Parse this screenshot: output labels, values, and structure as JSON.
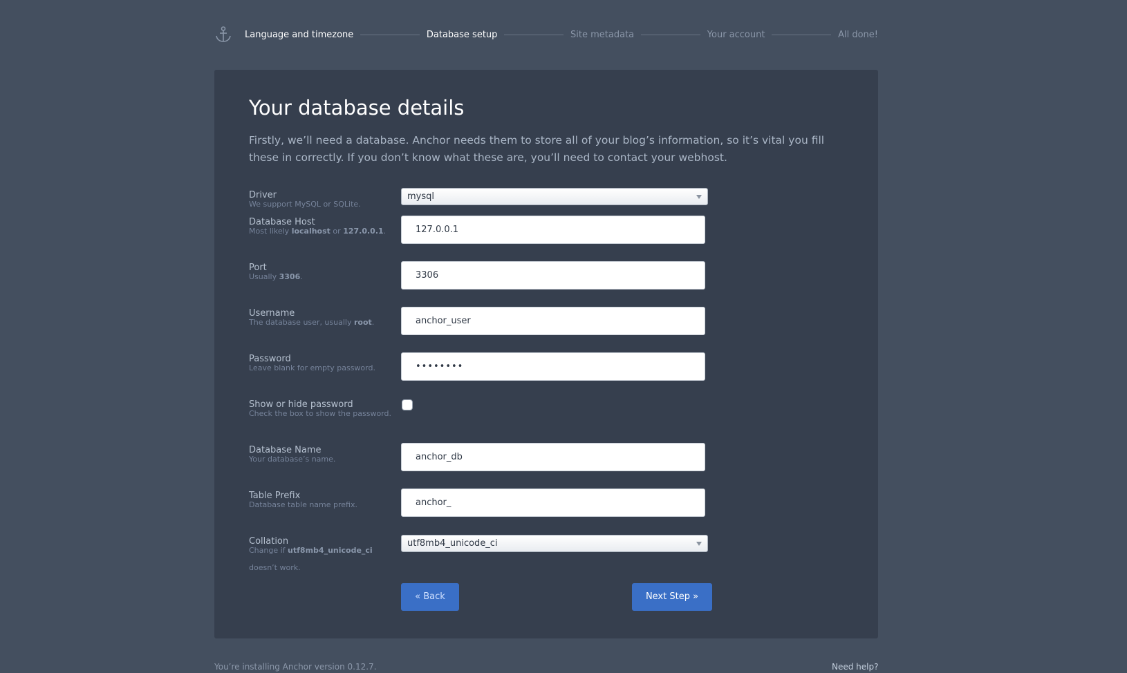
{
  "steps": [
    {
      "label": "Language and timezone",
      "state": "done"
    },
    {
      "label": "Database setup",
      "state": "current"
    },
    {
      "label": "Site metadata",
      "state": "upcoming"
    },
    {
      "label": "Your account",
      "state": "upcoming"
    },
    {
      "label": "All done!",
      "state": "upcoming"
    }
  ],
  "page": {
    "title": "Your database details",
    "intro": "Firstly, we’ll need a database. Anchor needs them to store all of your blog’s information, so it’s vital you fill these in correctly. If you don’t know what these are, you’ll need to contact your webhost."
  },
  "form": {
    "driver": {
      "label": "Driver",
      "hint": "We support MySQL or SQLite.",
      "value": "mysql"
    },
    "host": {
      "label": "Database Host",
      "hint_pre": "Most likely ",
      "hint_b1": "localhost",
      "hint_mid": " or ",
      "hint_b2": "127.0.0.1",
      "hint_post": ".",
      "value": "127.0.0.1"
    },
    "port": {
      "label": "Port",
      "hint_pre": "Usually ",
      "hint_b": "3306",
      "hint_post": ".",
      "value": "3306"
    },
    "username": {
      "label": "Username",
      "hint_pre": "The database user, usually ",
      "hint_b": "root",
      "hint_post": ".",
      "value": "anchor_user"
    },
    "password": {
      "label": "Password",
      "hint": "Leave blank for empty password.",
      "value": "••••••••"
    },
    "show_password": {
      "label": "Show or hide password",
      "hint": "Check the box to show the password."
    },
    "name": {
      "label": "Database Name",
      "hint": "Your database’s name.",
      "value": "anchor_db"
    },
    "prefix": {
      "label": "Table Prefix",
      "hint": "Database table name prefix.",
      "value": "anchor_"
    },
    "collation": {
      "label": "Collation",
      "hint_pre": "Change if ",
      "hint_b": "utf8mb4_unicode_ci",
      "hint_post": "doesn’t work.",
      "value": "utf8mb4_unicode_ci"
    }
  },
  "buttons": {
    "back": "« Back",
    "next": "Next Step »"
  },
  "footer": {
    "version": "You’re installing Anchor version 0.12.7.",
    "help": "Need help?"
  },
  "colors": {
    "background": "#444f5f",
    "panel": "#363f4e",
    "accent": "#3a6fc6"
  }
}
